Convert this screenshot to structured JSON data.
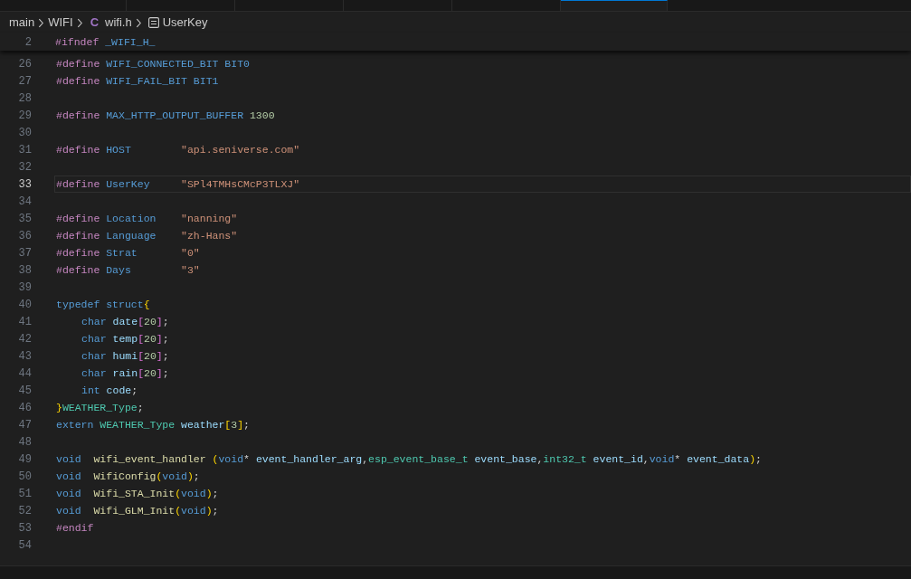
{
  "tabs": [
    {
      "selected": false
    },
    {
      "selected": false
    },
    {
      "selected": false
    },
    {
      "selected": false
    },
    {
      "selected": false
    },
    {
      "selected": true
    }
  ],
  "breadcrumb": [
    {
      "label": "main",
      "kind": "folder"
    },
    {
      "label": "WIFI",
      "kind": "folder"
    },
    {
      "label": "wifi.h",
      "kind": "file",
      "icon": "C"
    },
    {
      "label": "UserKey",
      "kind": "symbol"
    }
  ],
  "sticky_line": {
    "number": "2",
    "tokens": [
      {
        "kind": "kw",
        "text": "#ifndef "
      },
      {
        "kind": "macro",
        "text": "_WIFI_H_"
      }
    ]
  },
  "lines": [
    {
      "number": "26",
      "current": false,
      "indented": false,
      "tokens": [
        {
          "kind": "kw",
          "text": "#define "
        },
        {
          "kind": "macro",
          "text": "WIFI_CONNECTED_BIT BIT0"
        }
      ]
    },
    {
      "number": "27",
      "current": false,
      "indented": false,
      "tokens": [
        {
          "kind": "kw",
          "text": "#define "
        },
        {
          "kind": "macro",
          "text": "WIFI_FAIL_BIT BIT1"
        }
      ]
    },
    {
      "number": "28",
      "current": false
    },
    {
      "number": "29",
      "current": false,
      "indented": false,
      "tokens": [
        {
          "kind": "kw",
          "text": "#define "
        },
        {
          "kind": "macro",
          "text": "MAX_HTTP_OUTPUT_BUFFER "
        },
        {
          "kind": "num",
          "text": "1300"
        }
      ]
    },
    {
      "number": "30",
      "current": false
    },
    {
      "number": "31",
      "current": false,
      "indented": false,
      "tokens": [
        {
          "kind": "kw",
          "text": "#define "
        },
        {
          "kind": "macro",
          "text": "HOST        "
        },
        {
          "kind": "str",
          "text": "\"api.seniverse.com\""
        }
      ]
    },
    {
      "number": "32",
      "current": false
    },
    {
      "number": "33",
      "current": true,
      "indented": false,
      "tokens": [
        {
          "kind": "kw",
          "text": "#define "
        },
        {
          "kind": "macro",
          "text": "UserKey     "
        },
        {
          "kind": "str",
          "text": "\"SPl4TMHsCMcP3TLXJ\""
        }
      ]
    },
    {
      "number": "34",
      "current": false
    },
    {
      "number": "35",
      "current": false,
      "indented": false,
      "tokens": [
        {
          "kind": "kw",
          "text": "#define "
        },
        {
          "kind": "macro",
          "text": "Location    "
        },
        {
          "kind": "str",
          "text": "\"nanning\""
        }
      ]
    },
    {
      "number": "36",
      "current": false,
      "indented": false,
      "tokens": [
        {
          "kind": "kw",
          "text": "#define "
        },
        {
          "kind": "macro",
          "text": "Language    "
        },
        {
          "kind": "str",
          "text": "\"zh-Hans\""
        }
      ]
    },
    {
      "number": "37",
      "current": false,
      "indented": false,
      "tokens": [
        {
          "kind": "kw",
          "text": "#define "
        },
        {
          "kind": "macro",
          "text": "Strat       "
        },
        {
          "kind": "str",
          "text": "\"0\""
        }
      ]
    },
    {
      "number": "38",
      "current": false,
      "indented": false,
      "tokens": [
        {
          "kind": "kw",
          "text": "#define "
        },
        {
          "kind": "macro",
          "text": "Days        "
        },
        {
          "kind": "str",
          "text": "\"3\""
        }
      ]
    },
    {
      "number": "39",
      "current": false
    },
    {
      "number": "40",
      "current": false,
      "indented": false,
      "tokens": [
        {
          "kind": "type",
          "text": "typedef struct"
        },
        {
          "kind": "brace",
          "text": "{"
        }
      ]
    },
    {
      "number": "41",
      "current": false,
      "indented": true,
      "tokens": [
        {
          "kind": "type",
          "text": "char "
        },
        {
          "kind": "var",
          "text": "date"
        },
        {
          "kind": "bracket",
          "text": "["
        },
        {
          "kind": "num",
          "text": "20"
        },
        {
          "kind": "bracket",
          "text": "]"
        },
        {
          "kind": "punct",
          "text": ";"
        }
      ]
    },
    {
      "number": "42",
      "current": false,
      "indented": true,
      "tokens": [
        {
          "kind": "type",
          "text": "char "
        },
        {
          "kind": "var",
          "text": "temp"
        },
        {
          "kind": "bracket",
          "text": "["
        },
        {
          "kind": "num",
          "text": "20"
        },
        {
          "kind": "bracket",
          "text": "]"
        },
        {
          "kind": "punct",
          "text": ";"
        }
      ]
    },
    {
      "number": "43",
      "current": false,
      "indented": true,
      "tokens": [
        {
          "kind": "type",
          "text": "char "
        },
        {
          "kind": "var",
          "text": "humi"
        },
        {
          "kind": "bracket",
          "text": "["
        },
        {
          "kind": "num",
          "text": "20"
        },
        {
          "kind": "bracket",
          "text": "]"
        },
        {
          "kind": "punct",
          "text": ";"
        }
      ]
    },
    {
      "number": "44",
      "current": false,
      "indented": true,
      "tokens": [
        {
          "kind": "type",
          "text": "char "
        },
        {
          "kind": "var",
          "text": "rain"
        },
        {
          "kind": "bracket",
          "text": "["
        },
        {
          "kind": "num",
          "text": "20"
        },
        {
          "kind": "bracket",
          "text": "]"
        },
        {
          "kind": "punct",
          "text": ";"
        }
      ]
    },
    {
      "number": "45",
      "current": false,
      "indented": true,
      "tokens": [
        {
          "kind": "type",
          "text": "int "
        },
        {
          "kind": "var",
          "text": "code"
        },
        {
          "kind": "punct",
          "text": ";"
        }
      ]
    },
    {
      "number": "46",
      "current": false,
      "indented": false,
      "tokens": [
        {
          "kind": "brace",
          "text": "}"
        },
        {
          "kind": "typename",
          "text": "WEATHER_Type"
        },
        {
          "kind": "punct",
          "text": ";"
        }
      ]
    },
    {
      "number": "47",
      "current": false,
      "indented": false,
      "tokens": [
        {
          "kind": "type",
          "text": "extern "
        },
        {
          "kind": "typename",
          "text": "WEATHER_Type "
        },
        {
          "kind": "var",
          "text": "weather"
        },
        {
          "kind": "brace",
          "text": "["
        },
        {
          "kind": "num",
          "text": "3"
        },
        {
          "kind": "brace",
          "text": "]"
        },
        {
          "kind": "punct",
          "text": ";"
        }
      ]
    },
    {
      "number": "48",
      "current": false
    },
    {
      "number": "49",
      "current": false,
      "indented": false,
      "tokens": [
        {
          "kind": "type",
          "text": "void  "
        },
        {
          "kind": "fn",
          "text": "wifi_event_handler "
        },
        {
          "kind": "brace",
          "text": "("
        },
        {
          "kind": "type",
          "text": "void"
        },
        {
          "kind": "punct",
          "text": "* "
        },
        {
          "kind": "var",
          "text": "event_handler_arg"
        },
        {
          "kind": "punct",
          "text": ","
        },
        {
          "kind": "typename",
          "text": "esp_event_base_t "
        },
        {
          "kind": "var",
          "text": "event_base"
        },
        {
          "kind": "punct",
          "text": ","
        },
        {
          "kind": "typename",
          "text": "int32_t "
        },
        {
          "kind": "var",
          "text": "event_id"
        },
        {
          "kind": "punct",
          "text": ","
        },
        {
          "kind": "type",
          "text": "void"
        },
        {
          "kind": "punct",
          "text": "* "
        },
        {
          "kind": "var",
          "text": "event_data"
        },
        {
          "kind": "brace",
          "text": ")"
        },
        {
          "kind": "punct",
          "text": ";"
        }
      ]
    },
    {
      "number": "50",
      "current": false,
      "indented": false,
      "tokens": [
        {
          "kind": "type",
          "text": "void  "
        },
        {
          "kind": "fn",
          "text": "WifiConfig"
        },
        {
          "kind": "brace",
          "text": "("
        },
        {
          "kind": "type",
          "text": "void"
        },
        {
          "kind": "brace",
          "text": ")"
        },
        {
          "kind": "punct",
          "text": ";"
        }
      ]
    },
    {
      "number": "51",
      "current": false,
      "indented": false,
      "tokens": [
        {
          "kind": "type",
          "text": "void  "
        },
        {
          "kind": "fn",
          "text": "Wifi_STA_Init"
        },
        {
          "kind": "brace",
          "text": "("
        },
        {
          "kind": "type",
          "text": "void"
        },
        {
          "kind": "brace",
          "text": ")"
        },
        {
          "kind": "punct",
          "text": ";"
        }
      ]
    },
    {
      "number": "52",
      "current": false,
      "indented": false,
      "tokens": [
        {
          "kind": "type",
          "text": "void  "
        },
        {
          "kind": "fn",
          "text": "Wifi_GLM_Init"
        },
        {
          "kind": "brace",
          "text": "("
        },
        {
          "kind": "type",
          "text": "void"
        },
        {
          "kind": "brace",
          "text": ")"
        },
        {
          "kind": "punct",
          "text": ";"
        }
      ]
    },
    {
      "number": "53",
      "current": false,
      "indented": false,
      "tokens": [
        {
          "kind": "kw",
          "text": "#endif"
        }
      ]
    },
    {
      "number": "54",
      "current": false
    }
  ]
}
